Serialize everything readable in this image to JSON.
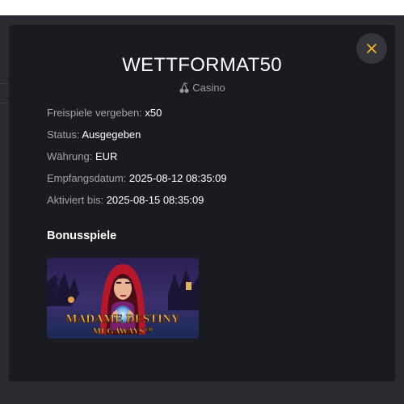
{
  "modal": {
    "title": "WETTFORMAT50",
    "category": "Casino",
    "category_icon": "cherries-icon",
    "close_icon": "close-icon"
  },
  "info_rows": [
    {
      "label": "Freispiele vergeben:",
      "value": "x50"
    },
    {
      "label": "Status:",
      "value": "Ausgegeben"
    },
    {
      "label": "Währung:",
      "value": "EUR"
    },
    {
      "label": "Empfangsdatum:",
      "value": "2025-08-12 08:35:09"
    },
    {
      "label": "Aktiviert bis:",
      "value": "2025-08-15 08:35:09"
    }
  ],
  "bonus_section": {
    "title": "Bonusspiele",
    "games": [
      {
        "name_line1": "MADAME DESTINY",
        "name_line2": "MEGAWAYS™"
      }
    ]
  },
  "colors": {
    "accent": "#f2b32b",
    "modal_background": "#1a1b20",
    "backdrop": "#2b2a30",
    "label_text": "#a3a3aa",
    "value_text": "#ffffff"
  }
}
